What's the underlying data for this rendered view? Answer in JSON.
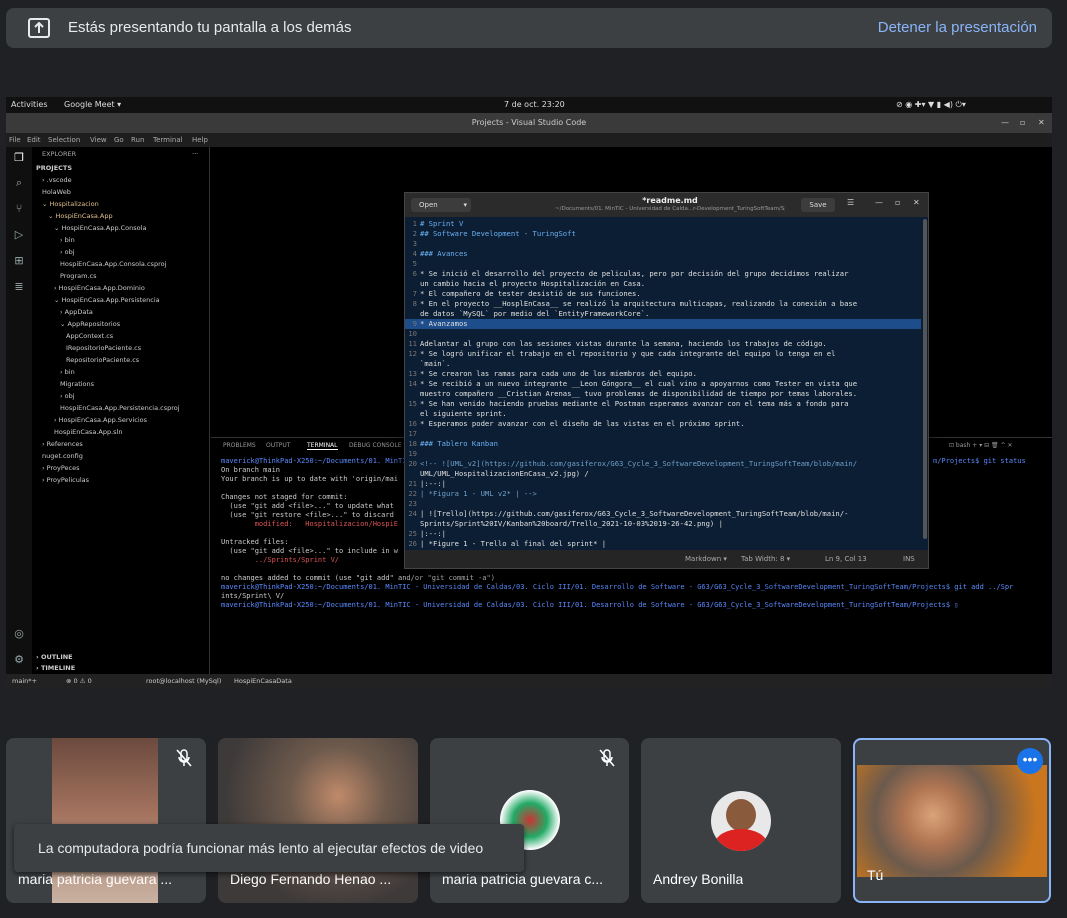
{
  "banner": {
    "message": "Estás presentando tu pantalla a los demás",
    "stop_label": "Detener la presentación",
    "icon": "present-to-all-icon"
  },
  "shared_screen": {
    "topbar": {
      "activities": "Activities",
      "app": "Google Meet ▾",
      "clock": "7 de oct. 23:20"
    },
    "window_title": "Projects - Visual Studio Code",
    "menu": [
      "File",
      "Edit",
      "Selection",
      "View",
      "Go",
      "Run",
      "Terminal",
      "Help"
    ],
    "explorer": {
      "title": "EXPLORER",
      "tree": [
        {
          "label": "PROJECTS",
          "indent": 0
        },
        {
          "label": "› .vscode",
          "indent": 1
        },
        {
          "label": "HolaWeb",
          "indent": 1
        },
        {
          "label": "⌄ Hospitalizacion",
          "indent": 1
        },
        {
          "label": "⌄ HospiEnCasa.App",
          "indent": 2
        },
        {
          "label": "⌄ HospiEnCasa.App.Consola",
          "indent": 3
        },
        {
          "label": "› bin",
          "indent": 4
        },
        {
          "label": "› obj",
          "indent": 4
        },
        {
          "label": "HospiEnCasa.App.Consola.csproj",
          "indent": 4
        },
        {
          "label": "Program.cs",
          "indent": 4
        },
        {
          "label": "› HospiEnCasa.App.Dominio",
          "indent": 3
        },
        {
          "label": "⌄ HospiEnCasa.App.Persistencia",
          "indent": 3
        },
        {
          "label": "› AppData",
          "indent": 4
        },
        {
          "label": "⌄ AppRepositorios",
          "indent": 4
        },
        {
          "label": "AppContext.cs",
          "indent": 5
        },
        {
          "label": "IRepositorioPaciente.cs",
          "indent": 5
        },
        {
          "label": "RepositorioPaciente.cs",
          "indent": 5
        },
        {
          "label": "› bin",
          "indent": 4
        },
        {
          "label": "Migrations",
          "indent": 4
        },
        {
          "label": "› obj",
          "indent": 4
        },
        {
          "label": "HospiEnCasa.App.Persistencia.csproj",
          "indent": 4
        },
        {
          "label": "› HospiEnCasa.App.Servicios",
          "indent": 3
        },
        {
          "label": "HospiEnCasa.App.sln",
          "indent": 3
        },
        {
          "label": "› References",
          "indent": 1
        },
        {
          "label": "nuget.config",
          "indent": 1
        },
        {
          "label": "› ProyPeces",
          "indent": 1
        },
        {
          "label": "› ProyPeliculas",
          "indent": 1
        }
      ],
      "outline": "› OUTLINE",
      "timeline": "› TIMELINE"
    },
    "panel_tabs": [
      "PROBLEMS",
      "OUTPUT",
      "TERMINAL",
      "DEBUG CONSOLE"
    ],
    "terminal_lines": [
      "maverick@ThinkPad-X250:~/Documents/01. MinTIC",
      "On branch main",
      "Your branch is up to date with 'origin/mai",
      "",
      "Changes not staged for commit:",
      "  (use \"git add <file>...\" to update what",
      "  (use \"git restore <file>...\" to discard",
      "        modified:   Hospitalizacion/HospiE",
      "",
      "Untracked files:",
      "  (use \"git add <file>...\" to include in w",
      "        ../Sprints/Sprint V/",
      "",
      "no changes added to commit (use \"git add\" and/or \"git commit -a\")",
      "maverick@ThinkPad-X250:~/Documents/01. MinTIC - Universidad de Caldas/03. Ciclo III/01. Desarrollo de Software - G63/G63_Cycle_3_SoftwareDevelopment_TuringSoftTeam/Projects$ git add ../Spr",
      "ints/Sprint\\ V/",
      "maverick@ThinkPad-X250:~/Documents/01. MinTIC - Universidad de Caldas/03. Ciclo III/01. Desarrollo de Software - G63/G63_Cycle_3_SoftwareDevelopment_TuringSoftTeam/Projects$ ▯"
    ],
    "terminal_git_status_tail": "m/Projects$ git status",
    "statusbar": {
      "branch": "main*+",
      "errors": "⊗ 0  ⚠ 0",
      "db": "root@localhost (MySql)",
      "project": "HospiEnCasaData"
    },
    "gedit": {
      "open_label": "Open",
      "file_name": "*readme.md",
      "file_path": "~/Documents/01. MinTIC - Universidad de Calda...r-Development_TuringSoftTeam/Sprints/Sprint V",
      "save_label": "Save",
      "lines": [
        {
          "n": "1",
          "t": "# Sprint V"
        },
        {
          "n": "2",
          "t": "## Software Development - TuringSoft"
        },
        {
          "n": "3",
          "t": ""
        },
        {
          "n": "4",
          "t": "### Avances"
        },
        {
          "n": "5",
          "t": ""
        },
        {
          "n": "6",
          "t": "* Se inició el desarrollo del proyecto de peliculas, pero por decisión del grupo decidimos realizar"
        },
        {
          "n": "",
          "t": "un cambio hacia el proyecto Hospitalización en Casa."
        },
        {
          "n": "7",
          "t": "* El compañero de tester desistió de sus funciones."
        },
        {
          "n": "8",
          "t": "* En el proyecto __HosplEnCasa__ se realizó la arquitectura multicapas, realizando la conexión a base"
        },
        {
          "n": "",
          "t": "de datos `MySQL` por medio del `EntityFrameworkCore`."
        },
        {
          "n": "9",
          "t": "* Avanzamos"
        },
        {
          "n": "10",
          "t": ""
        },
        {
          "n": "11",
          "t": "Adelantar al grupo con las sesiones vistas durante la semana, haciendo los trabajos de código."
        },
        {
          "n": "12",
          "t": "* Se logró unificar el trabajo en el repositorio y que cada integrante del equipo lo tenga en el"
        },
        {
          "n": "",
          "t": "`main`."
        },
        {
          "n": "13",
          "t": "* Se crearon las ramas para cada uno de los miembros del equipo."
        },
        {
          "n": "14",
          "t": "* Se recibió a un nuevo integrante __Leon Góngora__ el cual vino a apoyarnos como Tester en vista que"
        },
        {
          "n": "",
          "t": "muestro compañero __Cristian Arenas__ tuvo problemas de disponibilidad de tiempo por temas laborales."
        },
        {
          "n": "15",
          "t": "* Se han venido haciendo pruebas mediante el Postman esperamos avanzar con el tema más a fondo para"
        },
        {
          "n": "",
          "t": "el siguiente sprint."
        },
        {
          "n": "16",
          "t": "* Esperamos poder avanzar con el diseño de las vistas en el próximo sprint."
        },
        {
          "n": "17",
          "t": ""
        },
        {
          "n": "18",
          "t": "### Tablero Kanban"
        },
        {
          "n": "19",
          "t": ""
        },
        {
          "n": "20",
          "t": "<!-- ![UML_v2](https://github.com/gasiferox/G63_Cycle_3_SoftwareDevelopment_TuringSoftTeam/blob/main/"
        },
        {
          "n": "",
          "t": "UML/UML_HospitalizacionEnCasa_v2.jpg) /"
        },
        {
          "n": "21",
          "t": "|:--:|"
        },
        {
          "n": "22",
          "t": "| *Figura 1 - UML v2* | -->"
        },
        {
          "n": "23",
          "t": ""
        },
        {
          "n": "24",
          "t": "| ![Trello](https://github.com/gasiferox/G63_Cycle_3_SoftwareDevelopment_TuringSoftTeam/blob/main/-"
        },
        {
          "n": "",
          "t": "Sprints/Sprint%20IV/Kanban%20board/Trello_2021-10-03%2019-26-42.png) |"
        },
        {
          "n": "25",
          "t": "|:--:|"
        },
        {
          "n": "26",
          "t": "| *Figure 1 - Trello al final del sprint* |"
        },
        {
          "n": "27",
          "t": ""
        }
      ],
      "status": {
        "lang": "Markdown ▾",
        "tab": "Tab Width: 8 ▾",
        "pos": "Ln 9, Col 13",
        "mode": "INS"
      }
    }
  },
  "participants": [
    {
      "name": "maria patricia guevara ...",
      "muted": true
    },
    {
      "name": "Diego Fernando Henao ...",
      "muted": false
    },
    {
      "name": "maria patricia guevara c...",
      "muted": true
    },
    {
      "name": "Andrey Bonilla",
      "muted": false
    },
    {
      "name": "Tú",
      "muted": false
    }
  ],
  "toast": "La computadora podría funcionar más lento al ejecutar efectos de video",
  "colors": {
    "accent": "#8ab4f8",
    "tile_bg": "#3c4043",
    "page_bg": "#202124",
    "editor_bg": "#0c1e33"
  }
}
